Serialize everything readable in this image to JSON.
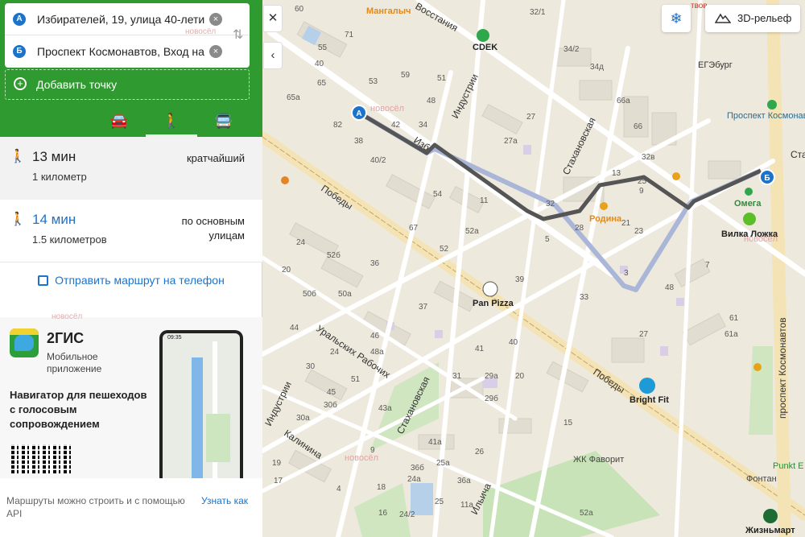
{
  "route": {
    "point_a_badge": "А",
    "point_a": "Избирателей, 19, улица 40-летия",
    "point_b_badge": "Б",
    "point_b": "Проспект Космонавтов, Вход на с",
    "clear_glyph": "×",
    "swap_glyph": "⇅",
    "add_point": "Добавить точку",
    "add_glyph": "+",
    "modes": [
      {
        "name": "car",
        "glyph": "🚘"
      },
      {
        "name": "walk",
        "glyph": "🚶"
      },
      {
        "name": "bus",
        "glyph": "🚍"
      }
    ]
  },
  "options": [
    {
      "icon": "walk",
      "time": "13 мин",
      "distance": "1 километр",
      "type": "кратчайший"
    },
    {
      "icon": "walk",
      "time": "14 мин",
      "distance": "1.5 километров",
      "type": "по основным улицам"
    }
  ],
  "send_to_phone": "Отправить маршрут на телефон",
  "promo": {
    "title": "2ГИС",
    "subtitle": "Мобильное приложение",
    "description": "Навигатор для пешеходов с голосовым сопровождением",
    "phone_time": "09:35"
  },
  "footer": {
    "text": "Маршруты можно строить и с помощью API",
    "link": "Узнать как"
  },
  "controls": {
    "collapse": "✕",
    "expand": "‹",
    "snow": "❄",
    "relief": "3D-рельеф"
  },
  "watermark": "новосёл",
  "map": {
    "streets": [
      "Восстания",
      "Индустрии",
      "Стахановская",
      "Победы",
      "Уральских Рабочих",
      "Калинина",
      "Ильича",
      "проспект Космонавтов",
      "Индустрии",
      "Стахановская",
      "Победы",
      "Изб"
    ],
    "pois": [
      "Мангалыч",
      "CDEK",
      "ЕГЭбург",
      "Проспект Космонавтов",
      "Родина",
      "Омега",
      "Вилка Ложка",
      "Pan Pizza",
      "Bright Fit",
      "ЖК Фаворит",
      "Фонтан",
      "Punkt E",
      "Жизньмарт",
      "твов",
      "Ста"
    ],
    "houses": [
      "60",
      "71",
      "55",
      "40",
      "32/1",
      "34/2",
      "34д",
      "65а",
      "59",
      "65",
      "53",
      "51",
      "48",
      "34",
      "66а",
      "66",
      "82",
      "40/2",
      "38",
      "42",
      "27а",
      "27",
      "13",
      "32в",
      "21",
      "25",
      "54",
      "11",
      "9",
      "52а",
      "52",
      "32",
      "28",
      "23",
      "67",
      "36",
      "5",
      "3",
      "7",
      "24",
      "20",
      "52б",
      "50б",
      "50а",
      "44",
      "37",
      "46",
      "40",
      "43а",
      "45",
      "39",
      "33",
      "41",
      "27",
      "48",
      "61а",
      "61",
      "51",
      "48а",
      "29а",
      "29б",
      "31",
      "9",
      "30",
      "30а",
      "30б",
      "24",
      "26",
      "41а",
      "36б",
      "36а",
      "18",
      "25а",
      "19",
      "24/2",
      "17",
      "16",
      "11а",
      "4",
      "25",
      "24а",
      "20",
      "15",
      "52а"
    ],
    "marker_a": "А",
    "marker_b": "Б"
  },
  "colors": {
    "green": "#2f9a2f",
    "blue": "#1d73c9",
    "route": "#555555",
    "route_alt": "#aab6d8"
  }
}
